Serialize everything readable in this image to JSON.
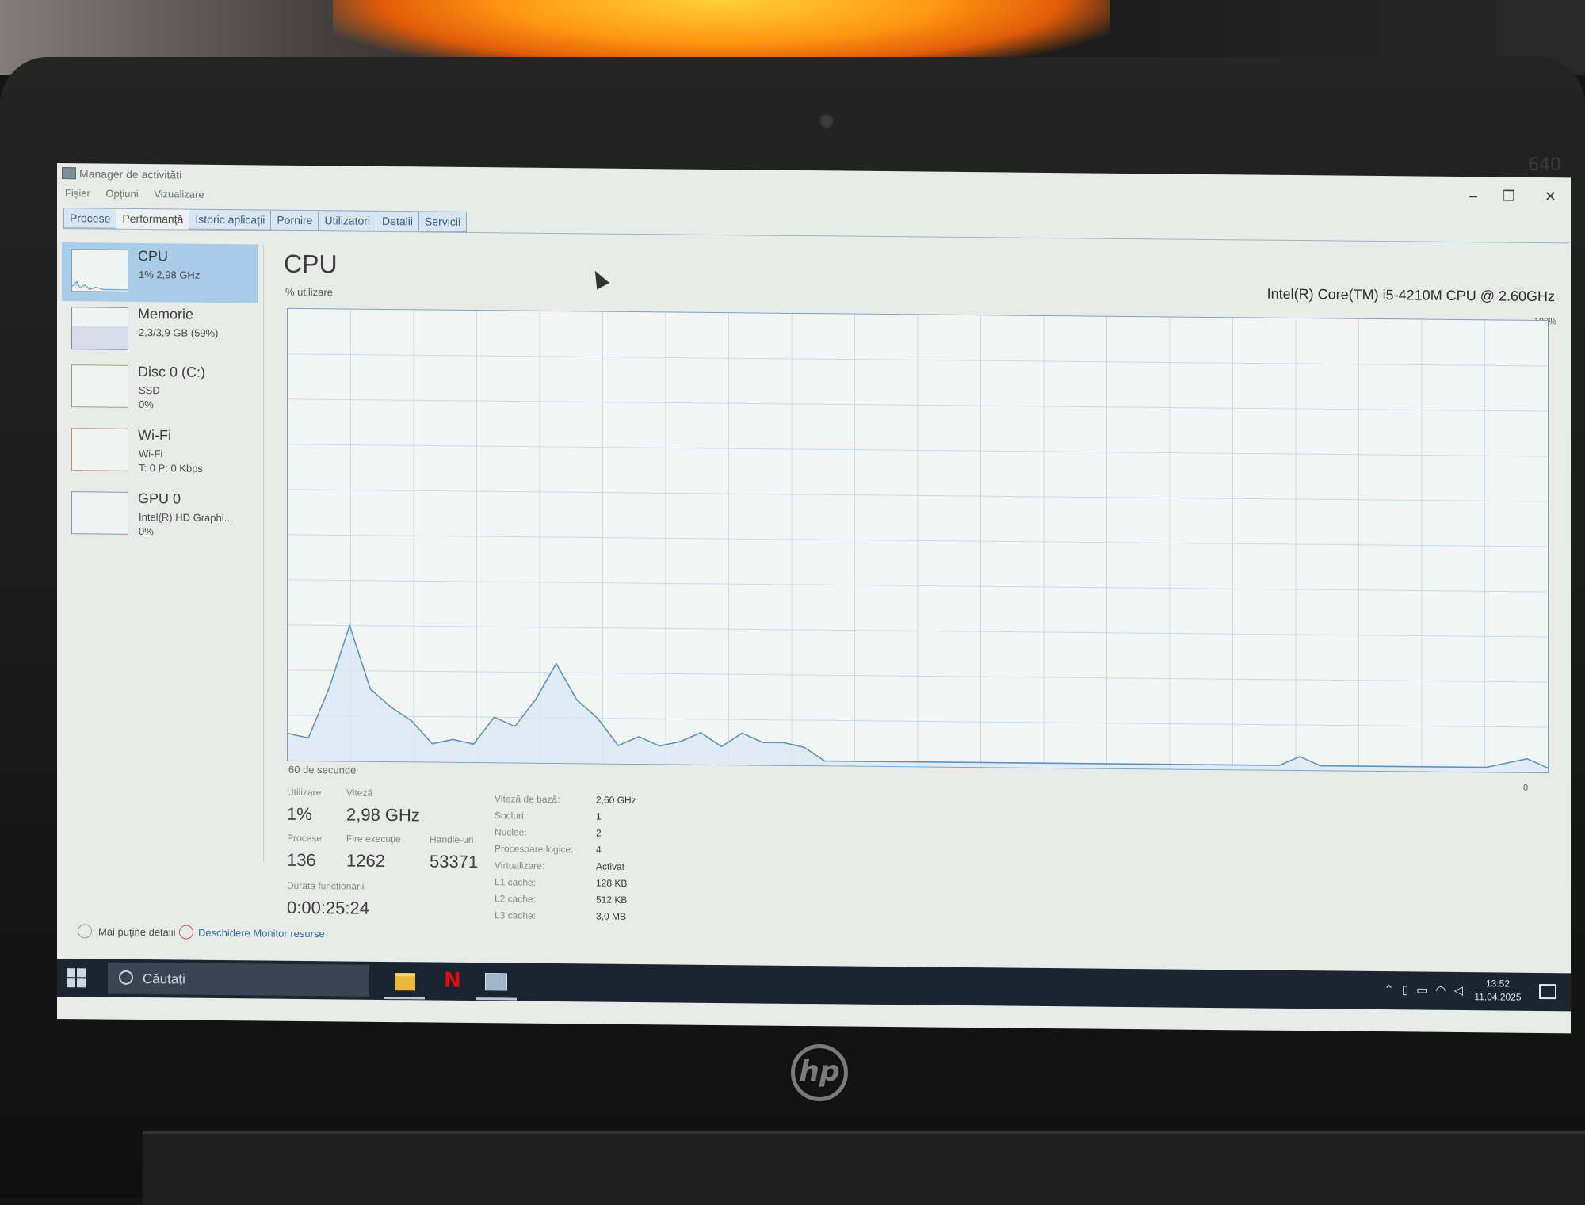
{
  "window": {
    "title": "Manager de activități",
    "minimize": "–",
    "restore": "❐",
    "close": "✕"
  },
  "menu": [
    "Fișier",
    "Opțiuni",
    "Vizualizare"
  ],
  "tabs": [
    "Procese",
    "Performanță",
    "Istoric aplicații",
    "Pornire",
    "Utilizatori",
    "Detalii",
    "Servicii"
  ],
  "active_tab": "Performanță",
  "sidebar": {
    "items": [
      {
        "name": "CPU",
        "line1": "1% 2,98 GHz",
        "line2": ""
      },
      {
        "name": "Memorie",
        "line1": "2,3/3,9 GB (59%)",
        "line2": ""
      },
      {
        "name": "Disc 0 (C:)",
        "line1": "SSD",
        "line2": "0%"
      },
      {
        "name": "Wi-Fi",
        "line1": "Wi-Fi",
        "line2": "T: 0 P: 0 Kbps"
      },
      {
        "name": "GPU 0",
        "line1": "Intel(R) HD Graphi...",
        "line2": "0%"
      }
    ]
  },
  "main": {
    "heading": "CPU",
    "model": "Intel(R) Core(TM) i5-4210M CPU @ 2.60GHz",
    "graph_label": "% utilizare",
    "graph_max": "100%",
    "graph_min": "0",
    "graph_time": "60 de secunde",
    "stats": {
      "util_label": "Utilizare",
      "util_value": "1%",
      "speed_label": "Viteză",
      "speed_value": "2,98 GHz",
      "proc_label": "Procese",
      "proc_value": "136",
      "threads_label": "Fire execuție",
      "threads_value": "1262",
      "handles_label": "Handle-uri",
      "handles_value": "53371",
      "uptime_label": "Durata funcționării",
      "uptime_value": "0:00:25:24"
    },
    "specs": [
      {
        "label": "Viteză de bază:",
        "value": "2,60 GHz"
      },
      {
        "label": "Socluri:",
        "value": "1"
      },
      {
        "label": "Nuclee:",
        "value": "2"
      },
      {
        "label": "Procesoare logice:",
        "value": "4"
      },
      {
        "label": "Virtualizare:",
        "value": "Activat"
      },
      {
        "label": "L1 cache:",
        "value": "128 KB"
      },
      {
        "label": "L2 cache:",
        "value": "512 KB"
      },
      {
        "label": "L3 cache:",
        "value": "3,0 MB"
      }
    ]
  },
  "footer": {
    "fewer_details": "Mai puține detalii",
    "resource_monitor": "Deschidere Monitor resurse"
  },
  "chart_data": {
    "type": "area",
    "ylim": [
      0,
      100
    ],
    "xlim": [
      60,
      0
    ],
    "series": [
      {
        "values": [
          6,
          5,
          16,
          30,
          16,
          12,
          9,
          4,
          5,
          4,
          10,
          8,
          14,
          22,
          14,
          10,
          4,
          6,
          4,
          5,
          7,
          4,
          7,
          5,
          5,
          4,
          1,
          1,
          1,
          1,
          1,
          1,
          1,
          1,
          1,
          1,
          1,
          1,
          1,
          1,
          1,
          1,
          1,
          1,
          1,
          1,
          1,
          1,
          1,
          3,
          1,
          1,
          1,
          1,
          1,
          1,
          1,
          1,
          1,
          2,
          3,
          1
        ]
      }
    ]
  },
  "taskbar": {
    "search_placeholder": "Căutați",
    "time": "13:52",
    "date": "11.04.2025",
    "tray_icons": [
      "chevron-up-icon",
      "phone-link-icon",
      "battery-icon",
      "wifi-icon",
      "volume-icon"
    ],
    "apps": [
      "file-explorer-icon",
      "netflix-icon",
      "task-manager-icon"
    ]
  },
  "device": {
    "model": "640",
    "brand": "hp"
  },
  "colors": {
    "cpu_line": "#5b95c2",
    "cpu_fill": "#dbe8f2",
    "selected_item": "#a9cde8",
    "taskbar": "#1b2431"
  }
}
